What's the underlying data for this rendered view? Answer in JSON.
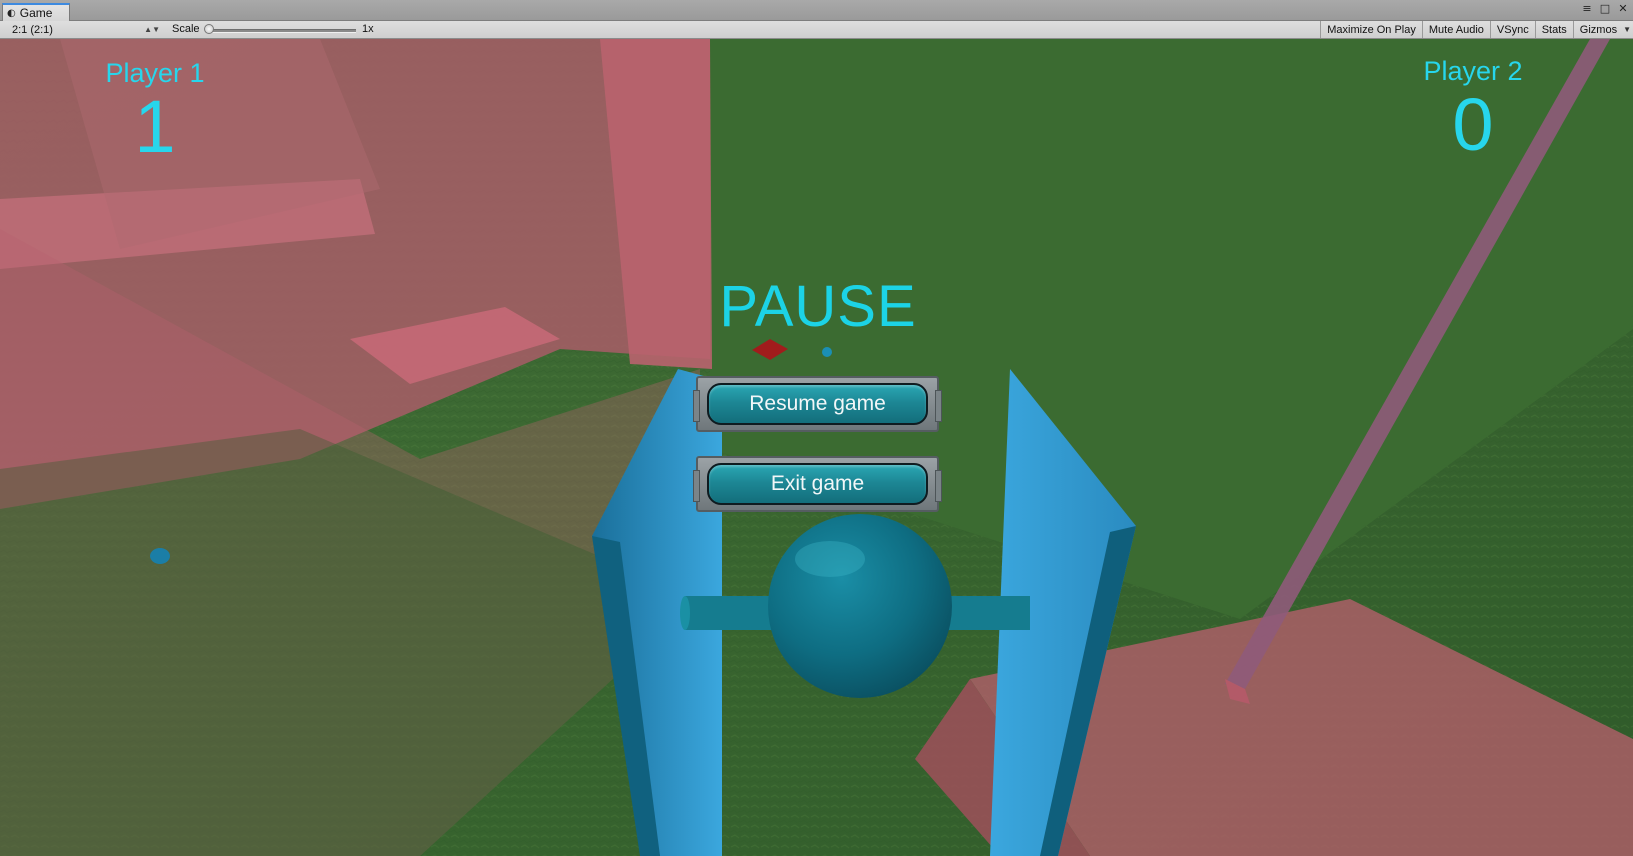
{
  "window": {
    "tab_label": "Game",
    "tab_icon": "game-controller-icon",
    "controls": [
      "menu-icon",
      "maximize-icon",
      "close-icon"
    ]
  },
  "toolbar": {
    "aspect_value": "2:1 (2:1)",
    "scale_label": "Scale",
    "scale_value": "1x",
    "scale_level": 0,
    "buttons": {
      "maximize": "Maximize On Play",
      "mute": "Mute Audio",
      "vsync": "VSync",
      "stats": "Stats",
      "gizmos": "Gizmos"
    }
  },
  "hud": {
    "player1": {
      "name": "Player 1",
      "score": "1"
    },
    "player2": {
      "name": "Player 2",
      "score": "0"
    }
  },
  "pause_menu": {
    "title": "PAUSE",
    "resume_label": "Resume game",
    "exit_label": "Exit game"
  },
  "colors": {
    "hud_text": "#27d6ec",
    "button_fill": "#1d8795",
    "tab_accent": "#3d8ae0",
    "floor_green": "#3d6a32",
    "wall_pink": "#b8646e",
    "ship_blue": "#1c8fc4"
  }
}
